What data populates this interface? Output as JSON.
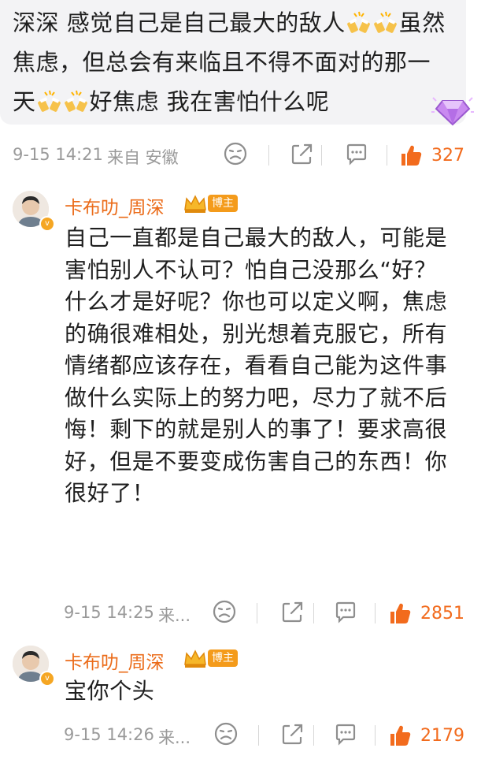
{
  "top_comment": {
    "text_part1": "深深 感觉自己是自己最大的敌人",
    "text_part2": "虽然焦虑，但总会有来临且不得不面对的那一天",
    "text_part3": "好焦虑 我在害怕什么呢",
    "emoji_name": "cheers-emoji",
    "badge_icon": "diamond-badge-icon",
    "time": "9-15 14:21",
    "location": "来自 安徽",
    "likes": "327"
  },
  "replies": [
    {
      "username": "卡布叻_周深",
      "tag": "博主",
      "text": "自己一直都是自己最大的敌人，可能是害怕别人不认可？怕自己没那么“好？什么才是好呢？你也可以定义啊，焦虑的确很难相处，别光想着克服它，所有情绪都应该存在，看看自己能为这件事做什么实际上的努力吧，尽力了就不后悔！剩下的就是别人的事了！要求高很好，但是不要变成伤害自己的东西！你很好了！",
      "time": "9-15 14:25",
      "location": "来...",
      "likes": "2851"
    },
    {
      "username": "卡布叻_周深",
      "tag": "博主",
      "text": "宝你个头",
      "time": "9-15 14:26",
      "location": "来...",
      "likes": "2179"
    }
  ],
  "colors": {
    "accent": "#eb6c1a",
    "like": "#f26b1d",
    "meta": "#9a9a9a",
    "bubble": "#f3f3f5"
  }
}
